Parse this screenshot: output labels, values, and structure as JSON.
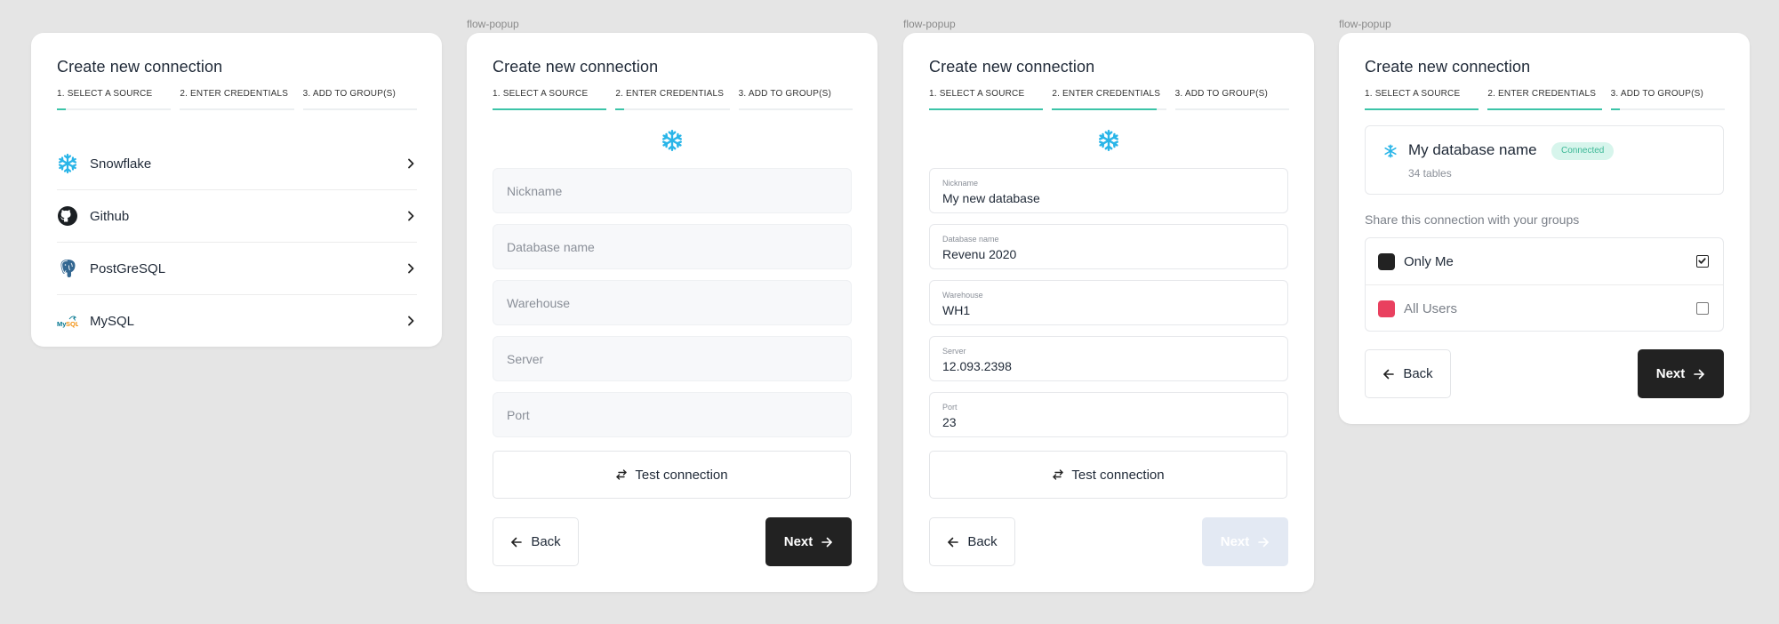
{
  "frame_label": "flow-popup",
  "title": "Create new connection",
  "steps": [
    "1. SELECT A SOURCE",
    "2. ENTER CREDENTIALS",
    "3. ADD TO GROUP(S)"
  ],
  "sources": [
    {
      "label": "Snowflake",
      "icon": "snowflake-icon"
    },
    {
      "label": "Github",
      "icon": "github-icon"
    },
    {
      "label": "PostGreSQL",
      "icon": "postgresql-icon"
    },
    {
      "label": "MySQL",
      "icon": "mysql-icon"
    }
  ],
  "credentials_empty": {
    "fields": [
      {
        "placeholder": "Nickname"
      },
      {
        "placeholder": "Database name"
      },
      {
        "placeholder": "Warehouse"
      },
      {
        "placeholder": "Server"
      },
      {
        "placeholder": "Port"
      }
    ]
  },
  "credentials_filled": {
    "fields": [
      {
        "label": "Nickname",
        "value": "My new database"
      },
      {
        "label": "Database name",
        "value": "Revenu 2020"
      },
      {
        "label": "Warehouse",
        "value": "WH1"
      },
      {
        "label": "Server",
        "value": "12.093.2398"
      },
      {
        "label": "Port",
        "value": "23"
      }
    ]
  },
  "buttons": {
    "test": "Test connection",
    "back": "Back",
    "next": "Next"
  },
  "group_step": {
    "db_name": "My database name",
    "db_status": "Connected",
    "db_sub": "34 tables",
    "share_label": "Share this connection with your groups",
    "groups": [
      {
        "label": "Only Me",
        "color": "#222222",
        "checked": true
      },
      {
        "label": "All Users",
        "color": "#e9405f",
        "checked": false
      }
    ]
  },
  "colors": {
    "accent": "#3cc4a8",
    "snowflake": "#29b5e8",
    "primary_button": "#222222",
    "disabled_button": "#e3e9f3"
  }
}
